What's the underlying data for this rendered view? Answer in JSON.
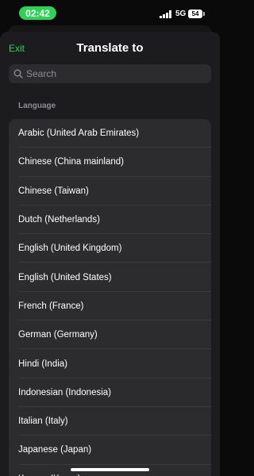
{
  "status_bar": {
    "time": "02:42",
    "network": "5G",
    "battery": "54",
    "accent_color": "#30d158"
  },
  "header": {
    "exit_label": "Exit",
    "title": "Translate to"
  },
  "search": {
    "placeholder": "Search",
    "icon": "search-icon"
  },
  "section": {
    "title": "Language"
  },
  "languages": [
    "Arabic (United Arab Emirates)",
    "Chinese (China mainland)",
    "Chinese (Taiwan)",
    "Dutch (Netherlands)",
    "English (United Kingdom)",
    "English (United States)",
    "French (France)",
    "German (Germany)",
    "Hindi (India)",
    "Indonesian (Indonesia)",
    "Italian (Italy)",
    "Japanese (Japan)",
    "Korean (Korea)"
  ]
}
